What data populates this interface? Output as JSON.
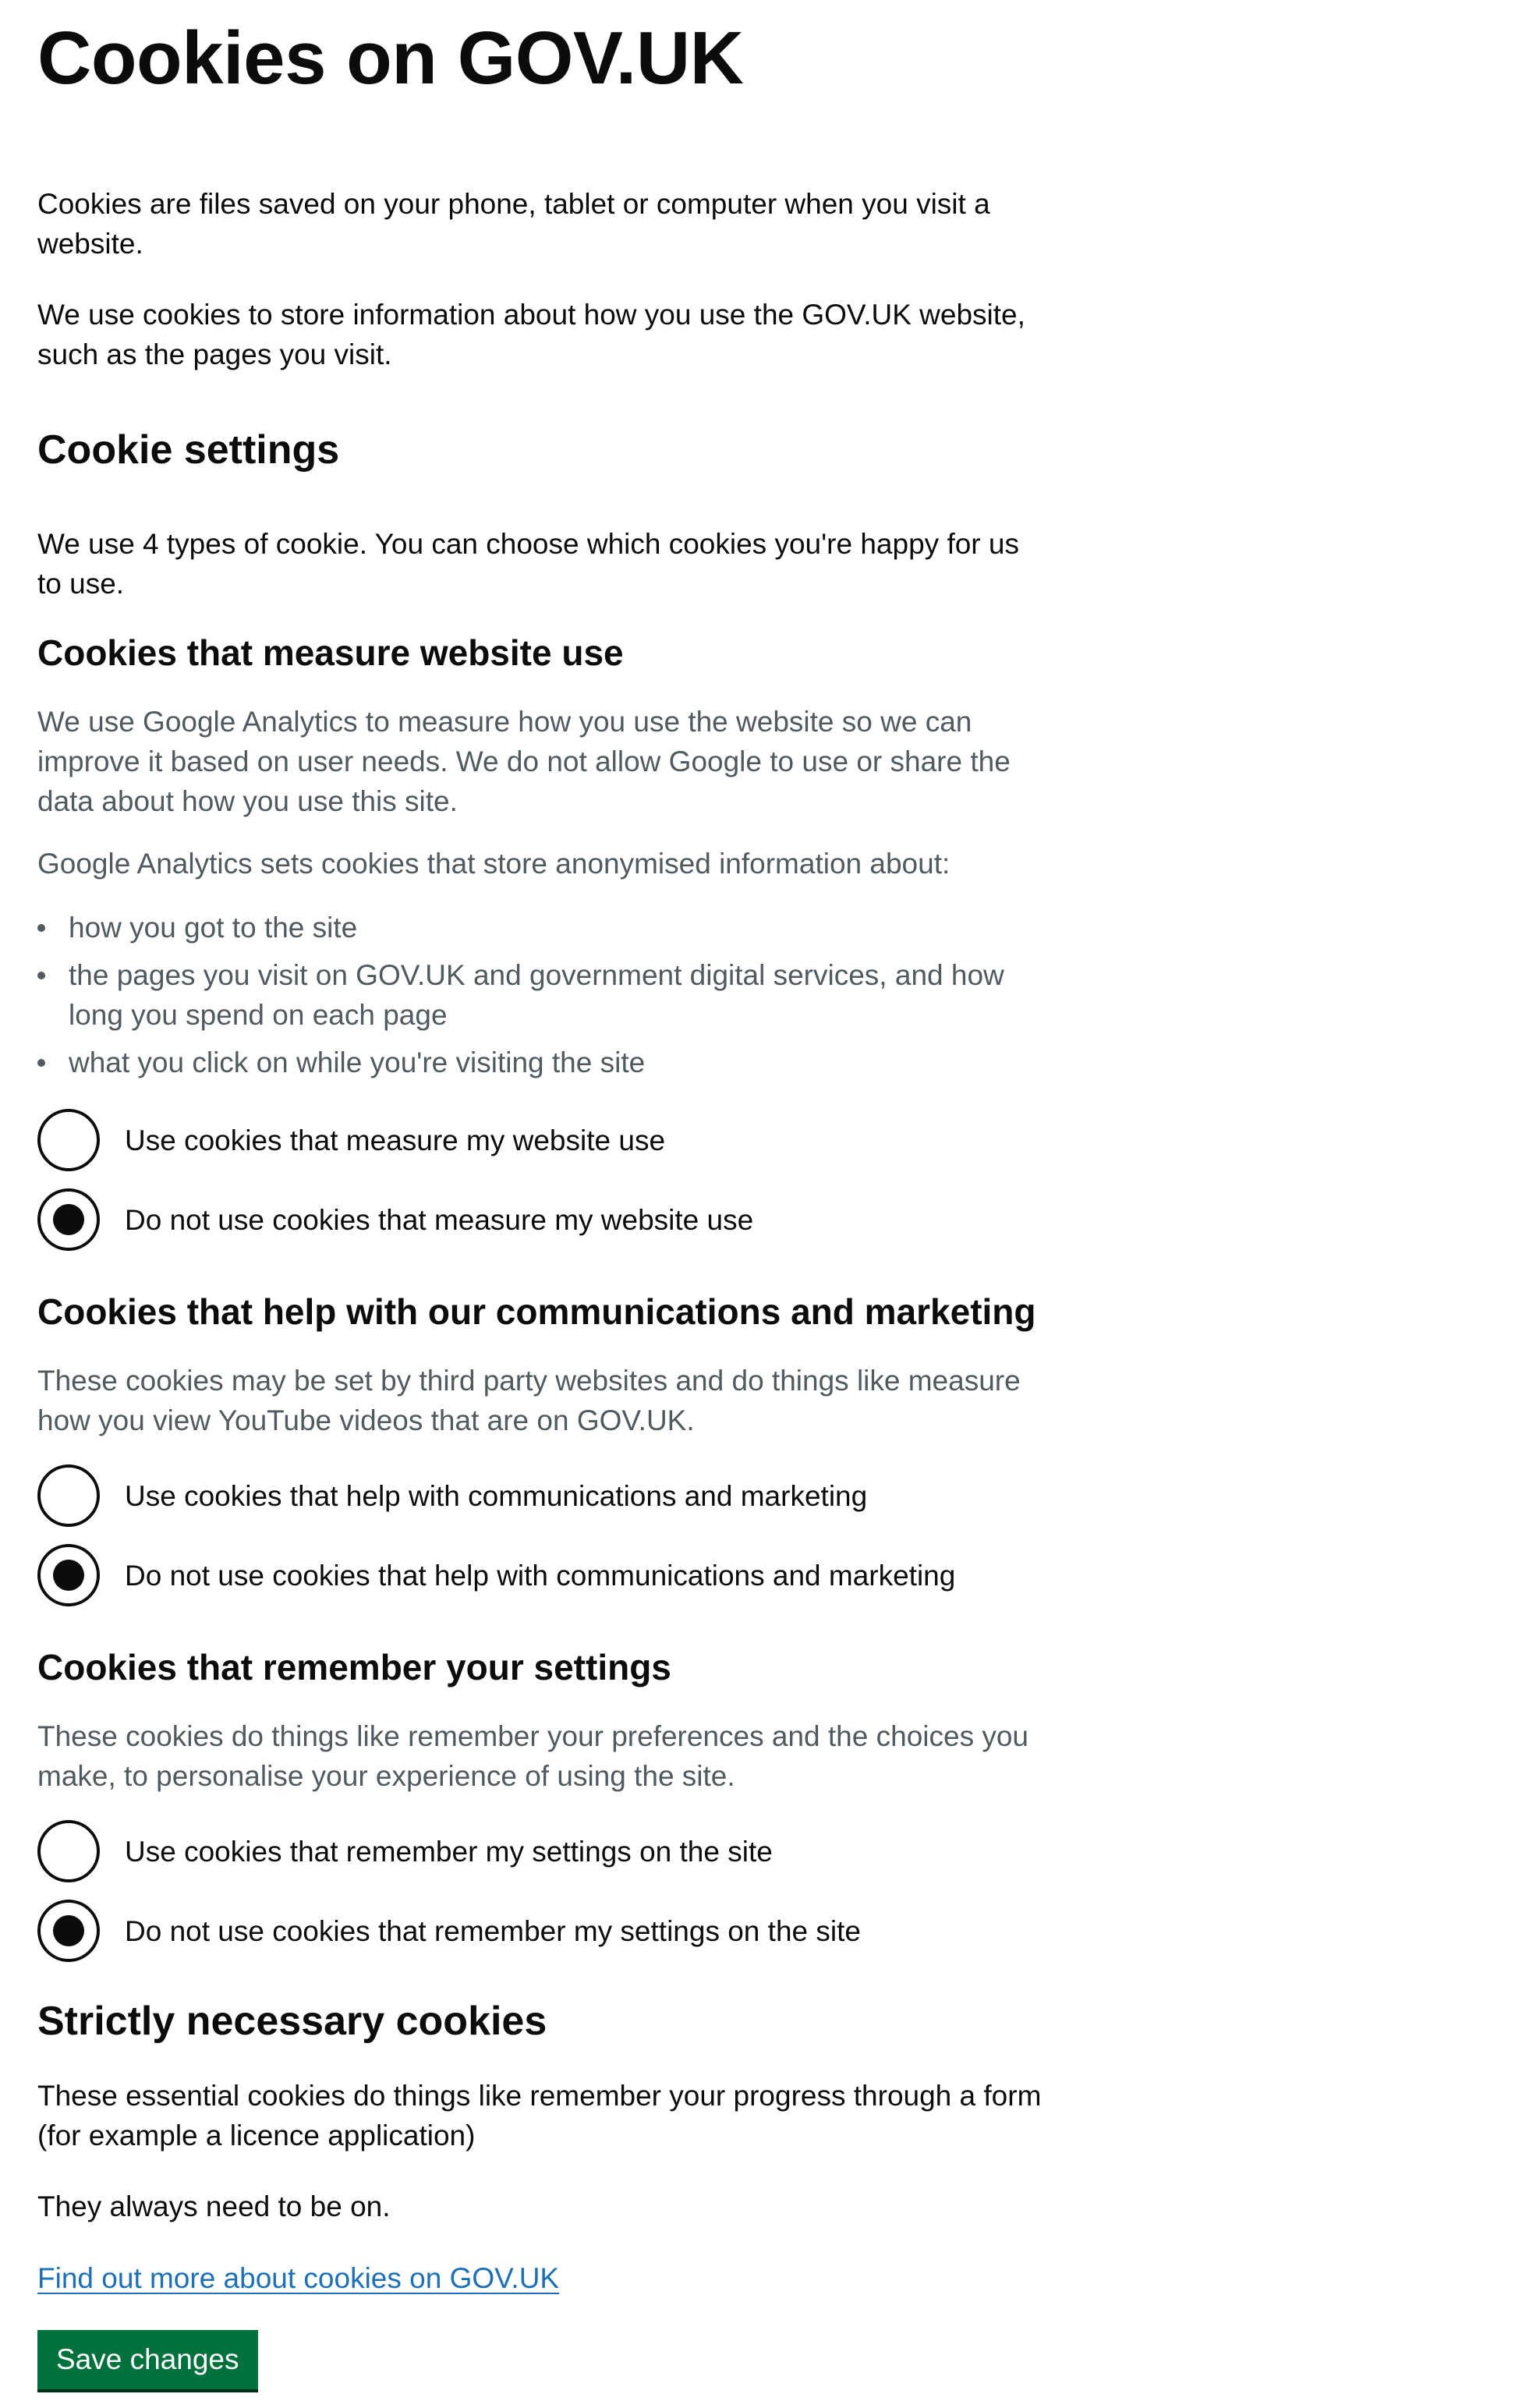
{
  "page": {
    "title": "Cookies on GOV.UK",
    "intro": [
      "Cookies are files saved on your phone, tablet or computer when you visit a website.",
      "We use cookies to store information about how you use the GOV.UK website, such as the pages you visit."
    ]
  },
  "settings": {
    "heading": "Cookie settings",
    "description": "We use 4 types of cookie. You can choose which cookies you're happy for us to use."
  },
  "sections": [
    {
      "heading": "Cookies that measure website use",
      "paragraphs": [
        "We use Google Analytics to measure how you use the website so we can improve it based on user needs. We do not allow Google to use or share the data about how you use this site.",
        "Google Analytics sets cookies that store anonymised information about:"
      ],
      "bullets": [
        "how you got to the site",
        "the pages you visit on GOV.UK and government digital services, and how long you spend on each page",
        "what you click on while you're visiting the site"
      ],
      "options": [
        {
          "label": "Use cookies that measure my website use",
          "selected": false
        },
        {
          "label": "Do not use cookies that measure my website use",
          "selected": true
        }
      ]
    },
    {
      "heading": "Cookies that help with our communications and marketing",
      "paragraphs": [
        "These cookies may be set by third party websites and do things like measure how you view YouTube videos that are on GOV.UK."
      ],
      "options": [
        {
          "label": "Use cookies that help with communications and marketing",
          "selected": false
        },
        {
          "label": "Do not use cookies that help with communications and marketing",
          "selected": true
        }
      ]
    },
    {
      "heading": "Cookies that remember your settings",
      "paragraphs": [
        "These cookies do things like remember your preferences and the choices you make, to personalise your experience of using the site."
      ],
      "options": [
        {
          "label": "Use cookies that remember my settings on the site",
          "selected": false
        },
        {
          "label": "Do not use cookies that remember my settings on the site",
          "selected": true
        }
      ]
    }
  ],
  "strictly_necessary": {
    "heading": "Strictly necessary cookies",
    "paragraphs": [
      "These essential cookies do things like remember your progress through a form (for example a licence application)",
      "They always need to be on."
    ]
  },
  "more_info_link": "Find out more about cookies on GOV.UK",
  "save_button": "Save changes",
  "colors": {
    "text": "#0b0c0c",
    "secondary_text": "#505a5f",
    "link": "#1d70b8",
    "button": "#00703c",
    "button_shadow": "#002d18"
  }
}
